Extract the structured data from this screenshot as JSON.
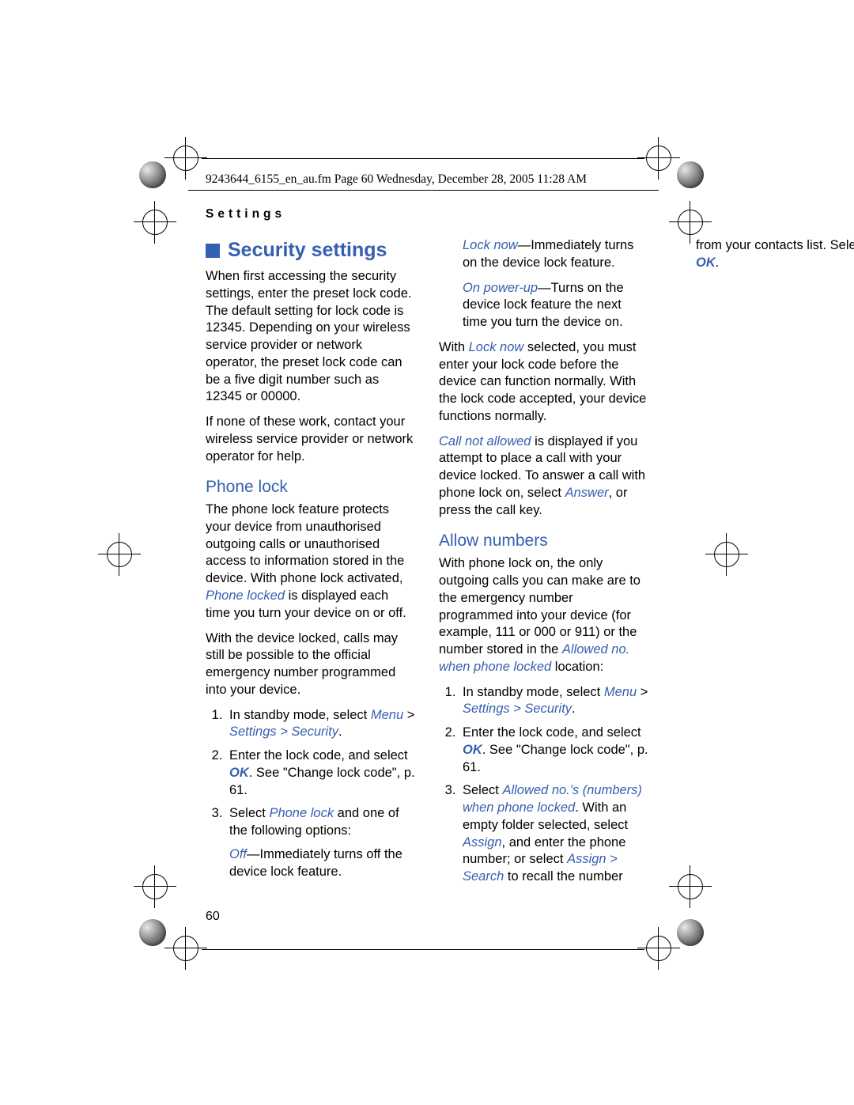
{
  "header": {
    "filename_line": "9243644_6155_en_au.fm  Page 60  Wednesday, December 28, 2005  11:28 AM",
    "section_label": "Settings"
  },
  "heading": "Security settings",
  "intro_para1": "When first accessing the security settings, enter the preset lock code. The default setting for lock code is 12345. Depending on your wireless service provider or network operator, the preset lock code can be a five digit number such as 12345 or 00000.",
  "intro_para2": "If none of these work, contact your wireless service provider or network operator for help.",
  "phone_lock_heading": "Phone lock",
  "phone_lock_para1_a": "The phone lock feature protects your device from unauthorised outgoing calls or unauthorised access to information stored in the device. With phone lock activated, ",
  "phone_lock_para1_b": "Phone locked",
  "phone_lock_para1_c": " is displayed each time you turn your device on or off.",
  "phone_lock_para2": "With the device locked, calls may still be possible to the official emergency number programmed into your device.",
  "list1_item1_a": "In standby mode, select ",
  "menu_text": "Menu",
  "gt": " > ",
  "settings_path": "Settings > Security",
  "period": ".",
  "list1_item2_a": "Enter the lock code, and select ",
  "ok_text": "OK",
  "list1_item2_b": ". See \"Change lock code\", p. 61.",
  "list1_item3_a": "Select ",
  "phone_lock_option": "Phone lock",
  "list1_item3_b": " and one of the following options:",
  "off_text": "Off",
  "off_desc": "—Immediately turns off the device lock feature.",
  "lock_now_text": "Lock now",
  "lock_now_desc": "—Immediately turns on the device lock feature.",
  "on_powerup_text": "On power-up",
  "on_powerup_desc": "—Turns on the device lock feature the next time you turn the device on.",
  "with_locknow_a": "With ",
  "with_locknow_b": "Lock now",
  "with_locknow_c": " selected, you must enter your lock code before the device can function normally. With the lock code accepted, your device functions normally.",
  "call_notallowed_text": "Call not allowed",
  "call_notallowed_a": " is displayed if you attempt to place a call with your device locked. To answer a call with phone lock on, select ",
  "answer_text": "Answer",
  "call_notallowed_b": ", or press the call key.",
  "allow_numbers_heading": "Allow numbers",
  "allow_para_a": "With phone lock on, the only outgoing calls you can make are to the emergency number programmed into your device (for example, 111 or 000 or 911) or the number stored in the ",
  "allowed_no_text": "Allowed no. when phone locked",
  "allow_para_b": " location:",
  "list2_item1_a": "In standby mode, select ",
  "list2_item2_a": "Enter the lock code, and select ",
  "list2_item2_b": ". See \"Change lock code\", p. 61.",
  "list2_item3_a": "Select ",
  "allowed_nos_numbers": "Allowed no.'s (numbers) when phone locked",
  "list2_item3_b": ". With an empty folder selected, select ",
  "assign_text": "Assign",
  "list2_item3_c": ", and enter the phone number; or select ",
  "assign_search": "Assign > Search",
  "list2_item3_d": " to recall the number from your contacts list. Select ",
  "page_number": "60"
}
